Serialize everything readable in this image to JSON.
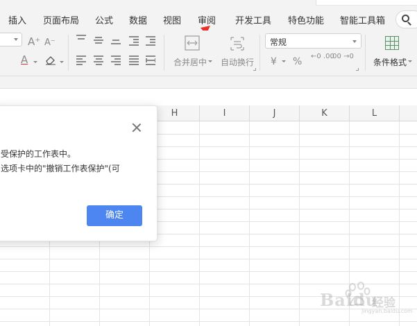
{
  "menu": {
    "tabs": [
      "插入",
      "页面布局",
      "公式",
      "数据",
      "视图",
      "审阅",
      "开发工具",
      "特色功能",
      "智能工具箱"
    ],
    "search_label": "Q"
  },
  "ribbon": {
    "font_increase": "A⁺",
    "font_decrease": "A⁻",
    "font_color_glyph": "A",
    "merge_center_label": "合并居中",
    "wrap_text_label": "自动换行",
    "number_format_value": "常规",
    "currency_glyph": "¥",
    "percent_glyph": "%",
    "decimal_increase": "←0 .00",
    "decimal_decrease": ".00 →0",
    "conditional_format_label": "条件格式"
  },
  "grid": {
    "columns": [
      "H",
      "I",
      "J",
      "K",
      "L"
    ]
  },
  "dialog": {
    "line1": "受保护的工作表中。",
    "line2": "选项卡中的\"撤销工作表保护\"(可",
    "ok_label": "确定"
  },
  "watermark": {
    "text": "Baidu",
    "sub": "经验",
    "url": "jingyan.baidu.com"
  },
  "colors": {
    "primary_button": "#4d86f0",
    "annotation_arrow": "#e8302a"
  }
}
